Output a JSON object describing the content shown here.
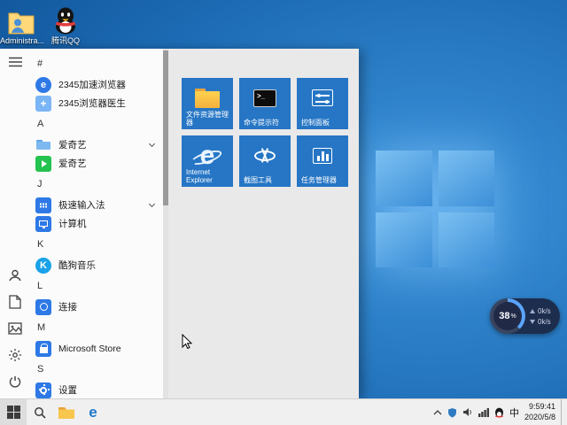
{
  "colors": {
    "tile": "#2676c5",
    "taskbar_bg": "#f0f0f0",
    "menu_bg": "#fbfbfb",
    "tiles_panel_bg": "#e9e9e9",
    "accent_blue": "#2e79e6",
    "iqiyi_green": "#24c24e",
    "qq_red": "#e23c3c"
  },
  "icon_glyphs": {
    "e2345": "e",
    "doctor_plus": "+",
    "kugou": "K",
    "ie": "e",
    "edge": "e",
    "cmd_prompt": ">_"
  },
  "desktop": {
    "icons": [
      {
        "label": "Administra...",
        "icon": "user-files-icon"
      },
      {
        "label": "腾讯QQ",
        "icon": "qq-penguin-icon"
      }
    ]
  },
  "start_menu": {
    "rail": {
      "top": [
        "hamburger-icon"
      ],
      "bottom": [
        "user-icon",
        "documents-icon",
        "pictures-icon",
        "settings-icon",
        "power-icon"
      ]
    },
    "app_list": [
      {
        "type": "header",
        "label": "#"
      },
      {
        "type": "app",
        "label": "2345加速浏览器"
      },
      {
        "type": "app",
        "label": "2345浏览器医生"
      },
      {
        "type": "header",
        "label": "A"
      },
      {
        "type": "app",
        "label": "爱奇艺",
        "expandable": true
      },
      {
        "type": "app",
        "label": "爱奇艺"
      },
      {
        "type": "header",
        "label": "J"
      },
      {
        "type": "app",
        "label": "极速输入法",
        "expandable": true
      },
      {
        "type": "app",
        "label": "计算机"
      },
      {
        "type": "header",
        "label": "K"
      },
      {
        "type": "app",
        "label": "酷狗音乐"
      },
      {
        "type": "header",
        "label": "L"
      },
      {
        "type": "app",
        "label": "连接"
      },
      {
        "type": "header",
        "label": "M"
      },
      {
        "type": "app",
        "label": "Microsoft Store"
      },
      {
        "type": "header",
        "label": "S"
      },
      {
        "type": "app",
        "label": "设置"
      }
    ],
    "tiles": [
      {
        "label": "文件资源管理器",
        "icon": "file-explorer-icon"
      },
      {
        "label": "命令提示符",
        "icon": "command-prompt-icon"
      },
      {
        "label": "控制面板",
        "icon": "control-panel-icon"
      },
      {
        "label": "Internet Explorer",
        "icon": "ie-icon"
      },
      {
        "label": "截图工具",
        "icon": "snipping-tool-icon"
      },
      {
        "label": "任务管理器",
        "icon": "task-manager-icon"
      }
    ]
  },
  "net_widget": {
    "percent": "38",
    "unit": "%",
    "up_speed": "0k/s",
    "down_speed": "0k/s"
  },
  "taskbar": {
    "ime_indicator": "中",
    "clock": {
      "time": "9:59:41",
      "date": "2020/5/8"
    }
  }
}
